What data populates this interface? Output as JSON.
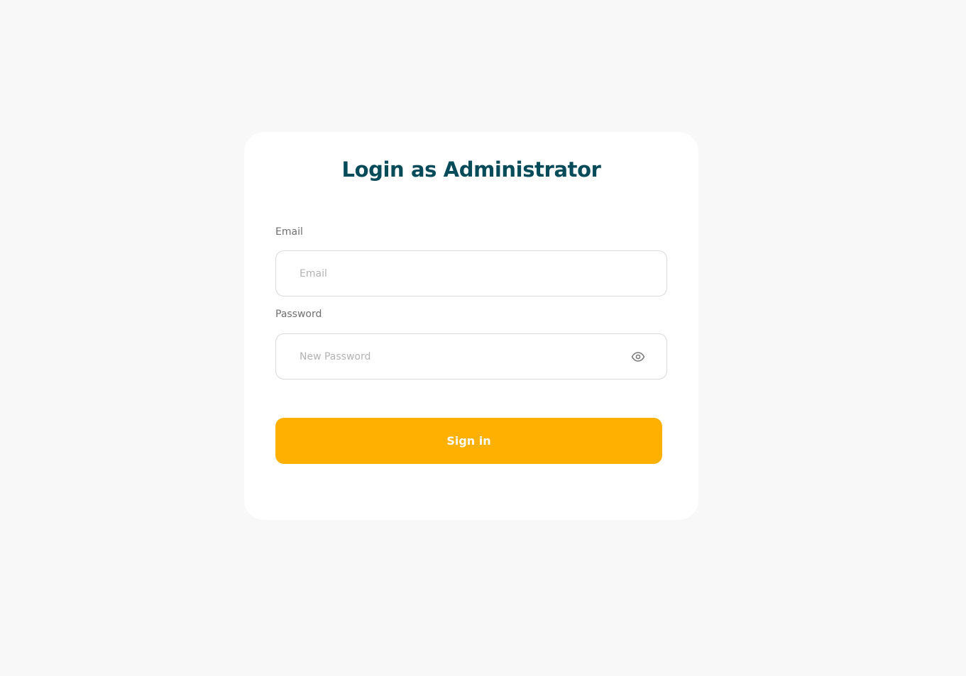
{
  "login": {
    "title": "Login as Administrator",
    "email": {
      "label": "Email",
      "placeholder": "Email",
      "value": ""
    },
    "password": {
      "label": "Password",
      "placeholder": "New Password",
      "value": "",
      "toggle_icon": "eye-icon"
    },
    "submit_label": "Sign in"
  },
  "colors": {
    "page_background": "#f8f8f8",
    "card_background": "#ffffff",
    "title": "#054b59",
    "button": "#ffb000",
    "button_text": "#ffffff",
    "input_border": "#d9d9d9"
  }
}
